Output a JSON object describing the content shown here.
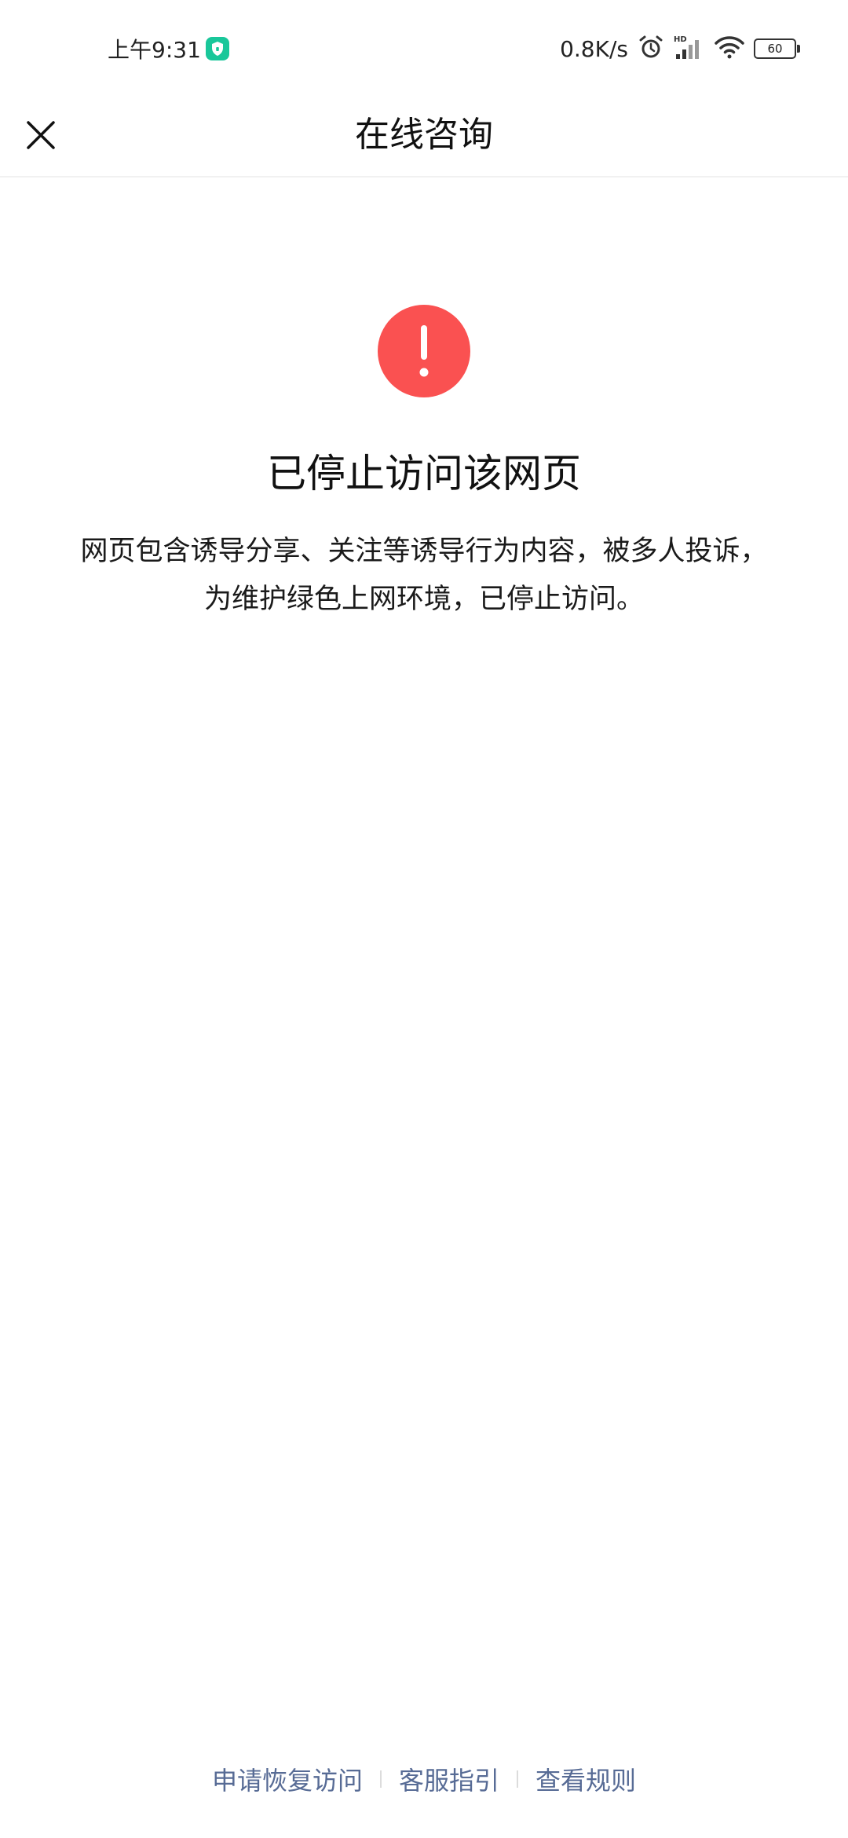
{
  "status_bar": {
    "time": "上午9:31",
    "network_speed": "0.8K/s",
    "battery_level": "60",
    "icons": [
      "shield-icon",
      "alarm-icon",
      "hd-signal-icon",
      "wifi-icon",
      "battery-icon"
    ],
    "shield_color": "#19c79a"
  },
  "nav": {
    "title": "在线咨询",
    "close_icon": "close-icon"
  },
  "content": {
    "warning_icon": "exclamation-circle-icon",
    "warning_color": "#fa5151",
    "title": "已停止访问该网页",
    "description_line1": "网页包含诱导分享、关注等诱导行为内容，被多人投诉，",
    "description_line2": "为维护绿色上网环境，已停止访问。"
  },
  "footer": {
    "link_color": "#576b95",
    "links": [
      {
        "label": "申请恢复访问"
      },
      {
        "label": "客服指引"
      },
      {
        "label": "查看规则"
      }
    ]
  }
}
